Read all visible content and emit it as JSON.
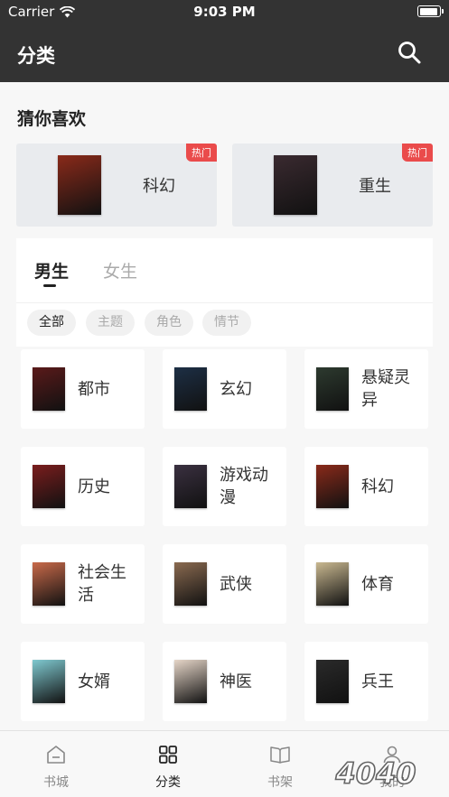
{
  "status_bar": {
    "carrier": "Carrier",
    "time": "9:03 PM"
  },
  "nav": {
    "title": "分类"
  },
  "guess": {
    "title": "猜你喜欢",
    "cards": [
      {
        "label": "科幻",
        "badge": "热门",
        "cover_color": "#8a2a1a"
      },
      {
        "label": "重生",
        "badge": "热门",
        "cover_color": "#3a2a30"
      }
    ]
  },
  "gender_tabs": [
    {
      "label": "男生",
      "active": true
    },
    {
      "label": "女生",
      "active": false
    }
  ],
  "filters": [
    {
      "label": "全部",
      "selected": true
    },
    {
      "label": "主题",
      "selected": false
    },
    {
      "label": "角色",
      "selected": false
    },
    {
      "label": "情节",
      "selected": false
    }
  ],
  "categories": [
    {
      "label": "都市",
      "cover_color": "#5a1a1a"
    },
    {
      "label": "玄幻",
      "cover_color": "#1d2f45"
    },
    {
      "label": "悬疑灵异",
      "cover_color": "#2d3a2f"
    },
    {
      "label": "历史",
      "cover_color": "#7a1d1d"
    },
    {
      "label": "游戏动漫",
      "cover_color": "#3a3040"
    },
    {
      "label": "科幻",
      "cover_color": "#8a2a1a"
    },
    {
      "label": "社会生活",
      "cover_color": "#c96a4a"
    },
    {
      "label": "武侠",
      "cover_color": "#8a6a50"
    },
    {
      "label": "体育",
      "cover_color": "#c9b890"
    },
    {
      "label": "女婿",
      "cover_color": "#7fc9d0"
    },
    {
      "label": "神医",
      "cover_color": "#e6d6c8"
    },
    {
      "label": "兵王",
      "cover_color": "#2a2a2a"
    }
  ],
  "tabbar": [
    {
      "label": "书城",
      "icon": "home-icon",
      "active": false
    },
    {
      "label": "分类",
      "icon": "grid-icon",
      "active": true
    },
    {
      "label": "书架",
      "icon": "book-icon",
      "active": false
    },
    {
      "label": "我的",
      "icon": "user-icon",
      "active": false
    }
  ],
  "watermark": "4040",
  "colors": {
    "header": "#333333",
    "badge": "#ea4b4b",
    "accent": "#222222"
  }
}
